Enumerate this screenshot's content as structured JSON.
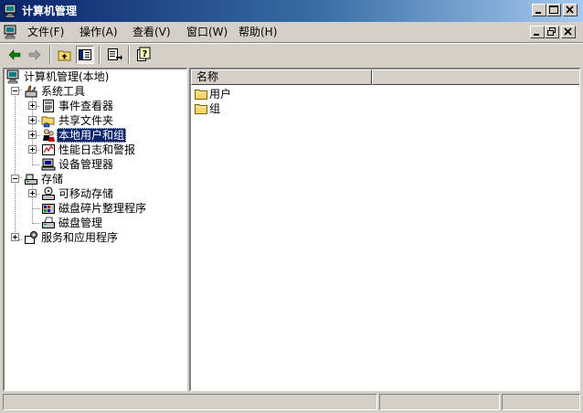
{
  "window": {
    "title": "计算机管理",
    "accent_color": "#0a246a",
    "caption_buttons": [
      "minimize",
      "maximize",
      "close"
    ]
  },
  "menu": {
    "items": [
      {
        "label": "文件(F)"
      },
      {
        "label": "操作(A)"
      },
      {
        "label": "查看(V)"
      },
      {
        "label": "窗口(W)"
      },
      {
        "label": "帮助(H)"
      }
    ],
    "mdi_buttons": [
      "minimize",
      "restore",
      "close"
    ]
  },
  "toolbar": {
    "buttons": [
      "back-icon",
      "forward-icon",
      "up-level-icon",
      "show-hide-console-tree-icon",
      "export-list-icon",
      "help-icon"
    ],
    "pressed": "show-hide-console-tree-icon"
  },
  "tree": {
    "items": [
      {
        "label": "计算机管理(本地)",
        "icon": "computer-management-icon",
        "expander": "none"
      },
      {
        "label": "系统工具",
        "icon": "system-tools-icon",
        "expander": "minus"
      },
      {
        "label": "事件查看器",
        "icon": "event-viewer-icon",
        "expander": "plus"
      },
      {
        "label": "共享文件夹",
        "icon": "shared-folder-icon",
        "expander": "plus"
      },
      {
        "label": "本地用户和组",
        "icon": "local-users-groups-icon",
        "expander": "plus",
        "selected": true
      },
      {
        "label": "性能日志和警报",
        "icon": "performance-logs-icon",
        "expander": "plus"
      },
      {
        "label": "设备管理器",
        "icon": "device-manager-icon",
        "expander": "none"
      },
      {
        "label": "存储",
        "icon": "storage-icon",
        "expander": "minus"
      },
      {
        "label": "可移动存储",
        "icon": "removable-storage-icon",
        "expander": "plus"
      },
      {
        "label": "磁盘碎片整理程序",
        "icon": "defragmenter-icon",
        "expander": "none"
      },
      {
        "label": "磁盘管理",
        "icon": "disk-management-icon",
        "expander": "none"
      },
      {
        "label": "服务和应用程序",
        "icon": "services-applications-icon",
        "expander": "plus"
      }
    ]
  },
  "list": {
    "column_header": "名称",
    "rows": [
      {
        "label": "用户",
        "icon": "folder-icon"
      },
      {
        "label": "组",
        "icon": "folder-icon"
      }
    ]
  },
  "status": {
    "panels": [
      "",
      "",
      ""
    ]
  }
}
